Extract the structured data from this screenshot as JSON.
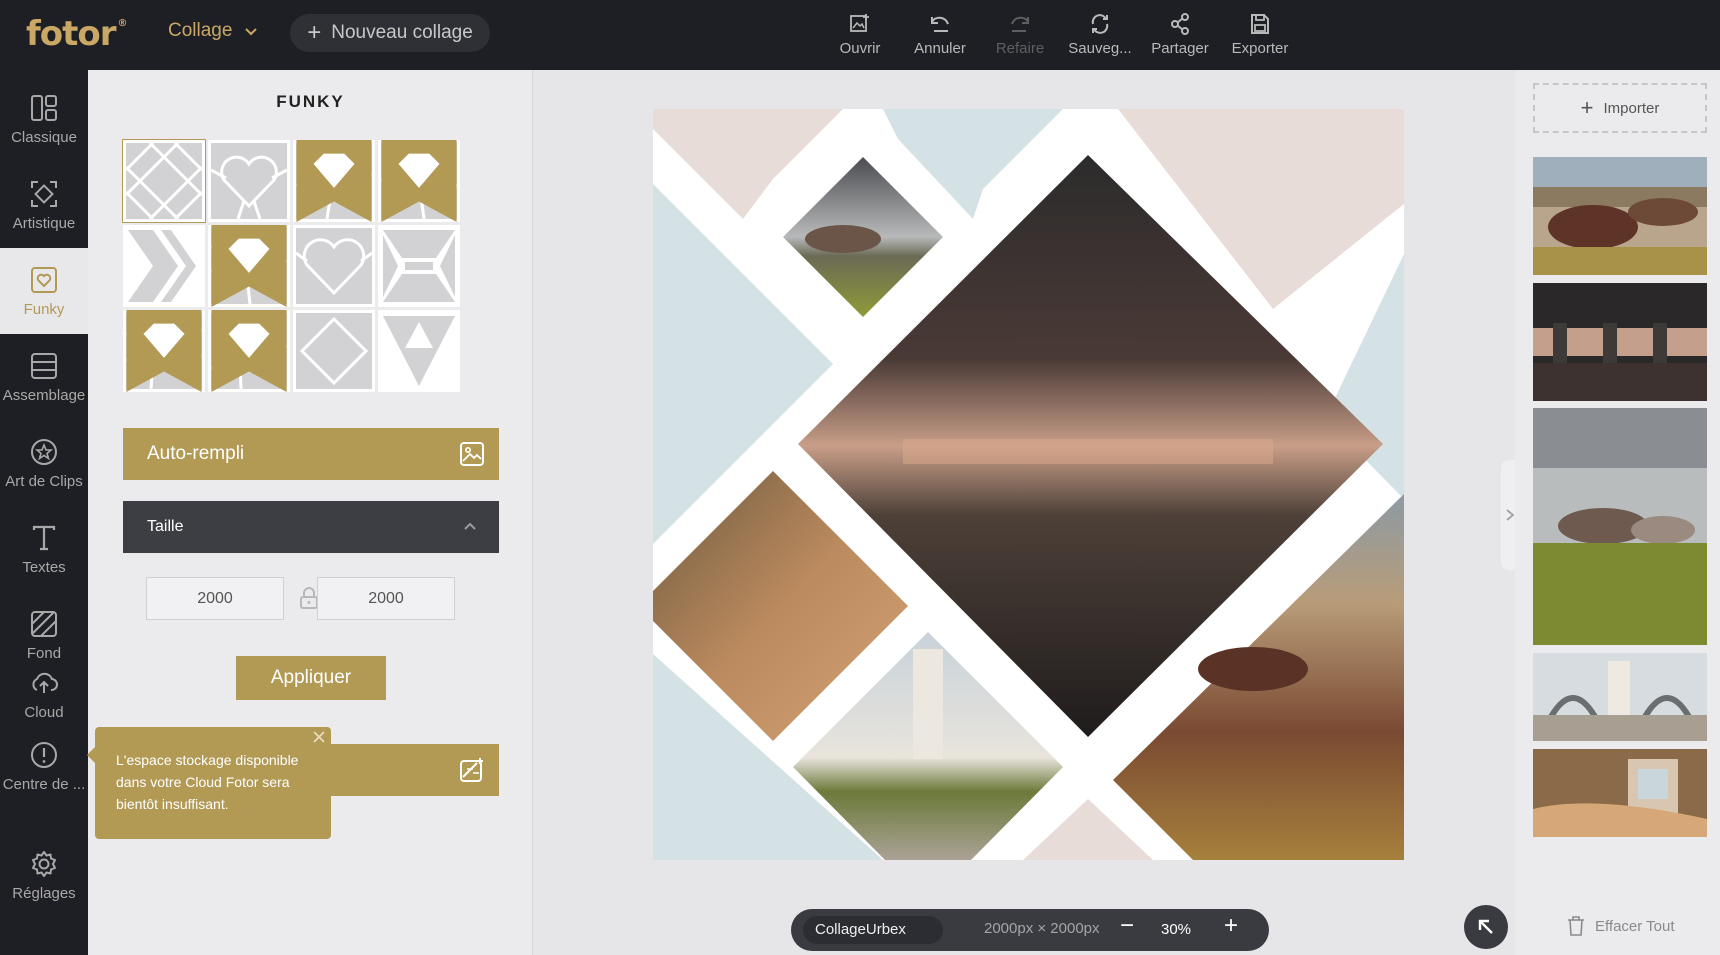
{
  "brand": {
    "logo_text": "fotor",
    "logo_mark": "®"
  },
  "header": {
    "mode_label": "Collage",
    "new_collage_label": "Nouveau collage",
    "tools": [
      {
        "label": "Ouvrir",
        "icon": "open-image-icon",
        "enabled": true
      },
      {
        "label": "Annuler",
        "icon": "undo-icon",
        "enabled": true
      },
      {
        "label": "Refaire",
        "icon": "redo-icon",
        "enabled": false
      },
      {
        "label": "Sauveg...",
        "icon": "save-cloud-icon",
        "enabled": true
      },
      {
        "label": "Partager",
        "icon": "share-icon",
        "enabled": true
      },
      {
        "label": "Exporter",
        "icon": "export-icon",
        "enabled": true
      }
    ]
  },
  "sidebar": {
    "items": [
      {
        "label": "Classique",
        "icon": "classic-layout-icon"
      },
      {
        "label": "Artistique",
        "icon": "artistic-icon"
      },
      {
        "label": "Funky",
        "icon": "funky-heart-icon",
        "active": true
      },
      {
        "label": "Assemblage",
        "icon": "assemblage-icon"
      },
      {
        "label": "Art de Clips",
        "icon": "clipart-star-icon"
      },
      {
        "label": "Textes",
        "icon": "text-icon"
      },
      {
        "label": "Fond",
        "icon": "background-icon"
      },
      {
        "label": "Cloud",
        "icon": "cloud-upload-icon"
      },
      {
        "label": "Centre de ...",
        "icon": "help-center-icon"
      },
      {
        "label": "Réglages",
        "icon": "settings-gear-icon"
      }
    ]
  },
  "panel": {
    "title": "FUNKY",
    "templates": [
      {
        "shape": "diamond-grid",
        "premium": false,
        "selected": true
      },
      {
        "shape": "heart",
        "premium": false
      },
      {
        "shape": "angled-split",
        "premium": true
      },
      {
        "shape": "angled-quad",
        "premium": true
      },
      {
        "shape": "chevrons",
        "premium": false
      },
      {
        "shape": "tilted-grid",
        "premium": true
      },
      {
        "shape": "heart-outline",
        "premium": false
      },
      {
        "shape": "hourglass",
        "premium": false
      },
      {
        "shape": "tilted-rows",
        "premium": true
      },
      {
        "shape": "tilted-columns",
        "premium": true
      },
      {
        "shape": "single-diamond",
        "premium": false
      },
      {
        "shape": "triangles",
        "premium": false
      }
    ],
    "autofill_label": "Auto-rempli",
    "size_label": "Taille",
    "width_value": "2000",
    "height_value": "2000",
    "apply_label": "Appliquer"
  },
  "tooltip": {
    "text": "L'espace stockage disponible dans votre Cloud Fotor sera bientôt insuffisant."
  },
  "canvas": {
    "collage_name": "CollageUrbex",
    "dimensions": "2000px × 2000px",
    "zoom": "30%"
  },
  "right_panel": {
    "import_label": "Importer",
    "clear_label": "Effacer Tout"
  },
  "colors": {
    "accent_gold": "#b29a55",
    "dark_bg": "#1e1f24",
    "pastel_pink": "#e8dcd8",
    "pastel_blue": "#d4e2e5"
  }
}
